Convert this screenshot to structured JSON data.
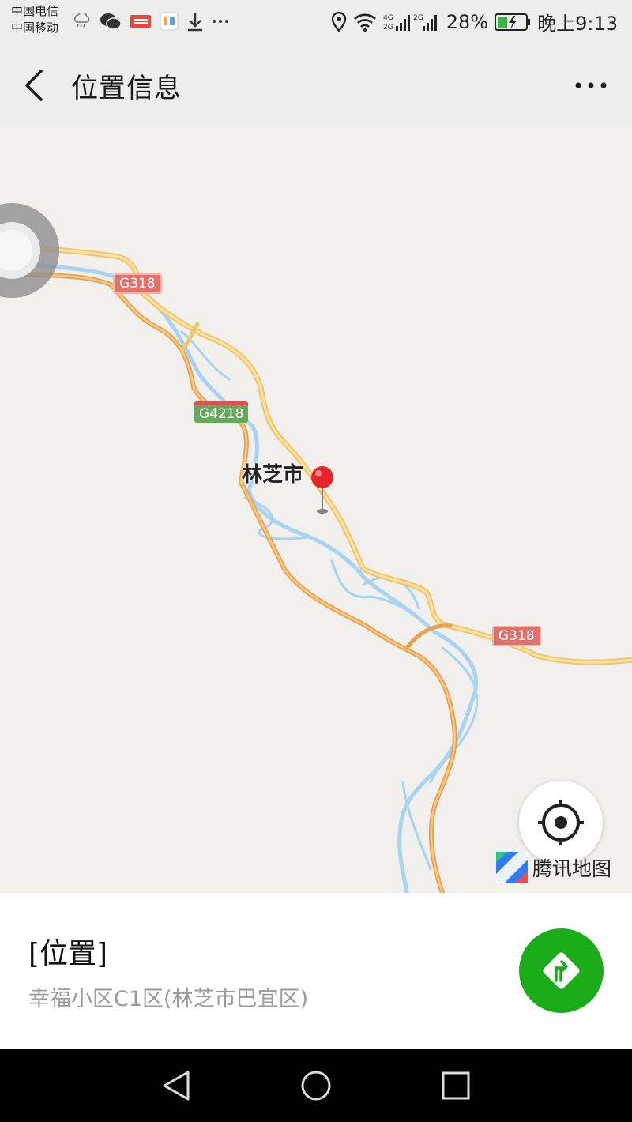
{
  "status_bar": {
    "carrier1": "中国电信",
    "carrier2": "中国移动",
    "battery": "28%",
    "time": "晚上9:13",
    "icons": [
      "cloud-rain-icon",
      "wechat-icon",
      "toutiao-icon",
      "58-icon",
      "download-icon",
      "more-dots-icon",
      "location-pin-icon",
      "wifi-icon",
      "signal-icon",
      "battery-charging-icon"
    ]
  },
  "app_bar": {
    "title": "位置信息"
  },
  "map": {
    "city": "林芝市",
    "road_labels": [
      "G318",
      "G4218",
      "G318"
    ],
    "provider": "腾讯地图",
    "colors": {
      "highway": "#f2c46b",
      "river": "#a8d3f3",
      "pin": "#e3262a",
      "background": "#f1f0ed"
    }
  },
  "location": {
    "title": "[位置]",
    "address": "幸福小区C1区(林芝市巴宜区)"
  },
  "accent_color": "#1aad19"
}
